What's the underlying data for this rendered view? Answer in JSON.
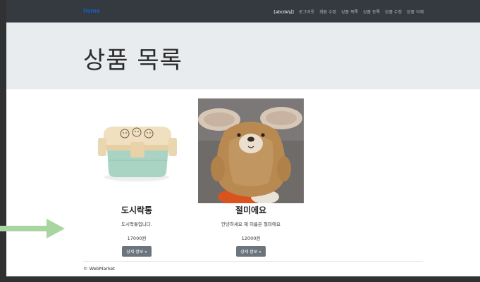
{
  "navbar": {
    "brand": "Home",
    "user": "[abcde님]",
    "items": [
      "로그아웃",
      "회원 수정",
      "상품 목록",
      "상품 등록",
      "상품 수정",
      "상품 삭제"
    ]
  },
  "jumbotron": {
    "title": "상품 목록"
  },
  "products": [
    {
      "name": "도시락통",
      "description": "도시락통입니다.",
      "price": "17000원",
      "button": "상세 정보 »",
      "image": "lunchbox-image"
    },
    {
      "name": "절미에요",
      "description": "안녕하세요 제 이름은 절미에요",
      "price": "12000원",
      "button": "상세 정보 »",
      "image": "plush-toy-image"
    }
  ],
  "footer": {
    "copyright": "© WebMarket"
  },
  "colors": {
    "navbar": "#343a40",
    "brand": "#0d6efd",
    "jumbotron": "#e9ecef",
    "button": "#6c757d",
    "arrow": "#a8d5a0"
  }
}
